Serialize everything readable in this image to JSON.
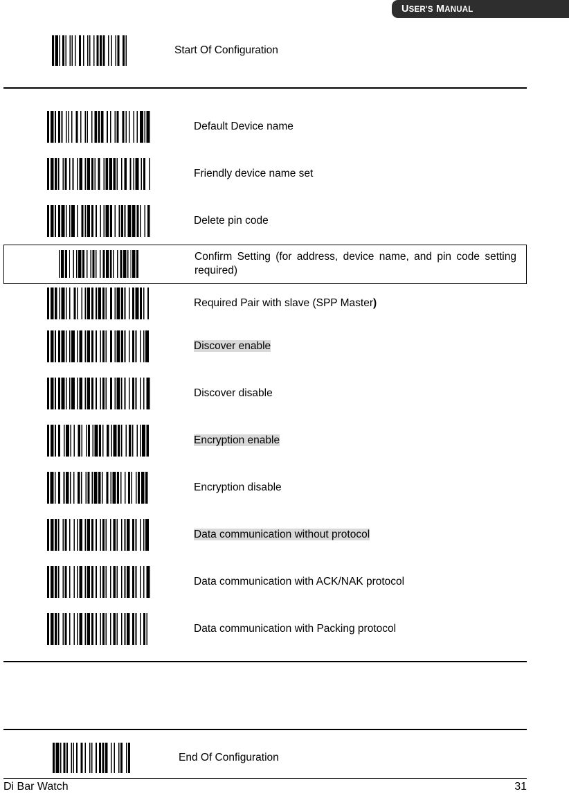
{
  "header": {
    "title_full": "USER'S MANUAL",
    "title_word1_cap": "U",
    "title_word1_rest": "SER'S",
    "title_word2_cap": "M",
    "title_word2_rest": "ANUAL",
    "background_color": "#2e2e2e",
    "text_color": "#ffffff"
  },
  "highlight_color": "#d9d9d9",
  "rows": {
    "start": {
      "label": "Start Of Configuration",
      "barcode_name": "barcode-start-of-configuration",
      "highlighted": false
    },
    "items": [
      {
        "label": "Default Device name",
        "barcode_name": "barcode-default-device-name",
        "highlighted": false,
        "boxed": false
      },
      {
        "label": "Friendly device name set",
        "barcode_name": "barcode-friendly-device-name-set",
        "highlighted": false,
        "boxed": false
      },
      {
        "label": "Delete pin code",
        "barcode_name": "barcode-delete-pin-code",
        "highlighted": false,
        "boxed": false
      },
      {
        "label": "Confirm Setting (for address, device name, and pin code setting required)",
        "barcode_name": "barcode-confirm-setting",
        "highlighted": false,
        "boxed": true
      },
      {
        "label": "Required Pair with slave (SPP Master)",
        "label_plain": "Required Pair with slave (SPP Master",
        "label_bold_tail": ")",
        "barcode_name": "barcode-required-pair-with-slave",
        "highlighted": false,
        "boxed": false
      },
      {
        "label": "Discover enable",
        "barcode_name": "barcode-discover-enable",
        "highlighted": true,
        "boxed": false
      },
      {
        "label": "Discover disable",
        "barcode_name": "barcode-discover-disable",
        "highlighted": false,
        "boxed": false
      },
      {
        "label": "Encryption enable",
        "barcode_name": "barcode-encryption-enable",
        "highlighted": true,
        "boxed": false
      },
      {
        "label": "Encryption disable",
        "barcode_name": "barcode-encryption-disable",
        "highlighted": false,
        "boxed": false
      },
      {
        "label": "Data communication without protocol",
        "barcode_name": "barcode-data-communication-without-protocol",
        "highlighted": true,
        "boxed": false
      },
      {
        "label": "Data communication with ACK/NAK protocol",
        "barcode_name": "barcode-data-communication-ack-nak",
        "highlighted": false,
        "boxed": false
      },
      {
        "label": "Data communication with Packing protocol",
        "barcode_name": "barcode-data-communication-packing",
        "highlighted": false,
        "boxed": false
      }
    ],
    "end": {
      "label": "End Of Configuration",
      "barcode_name": "barcode-end-of-configuration",
      "highlighted": false
    }
  },
  "footer": {
    "left": "Di Bar Watch",
    "page_number": "31"
  },
  "barcode_patterns": {
    "start": "2131122113111213221311131221212312131123211",
    "default_device": "21311221131112132213111312212123121311232112131212311131",
    "friendly_name": "21312113112212131132113121122311213121131223121132112311",
    "delete_pin": "21311221311211321321113122131211312213112112313121131221",
    "confirm": "113122131211312213112113122131211312213112113122",
    "required_pair": "21312211311213211312113122113121132211312113122131211312",
    "discover_enable": "21311221311211321132113122131121132211312113122113121132",
    "discover_disable": "21311221311211321132113122131121132211311213122113121231",
    "encryption_enable": "21311223113112132113112211312113221131211312211312113122",
    "encryption_disable": "21311223113112132113112211312113221131211312211311213123",
    "data_no_protocol": "21312113112213121132113122131121131221131211322113121132",
    "data_ack_nak": "21312113112213121132113122131121131221131211322113121231",
    "data_packing": "21312113112213121132113122131121131221131211322113122113",
    "end": "2131122113111213221311131221212312131123112"
  }
}
